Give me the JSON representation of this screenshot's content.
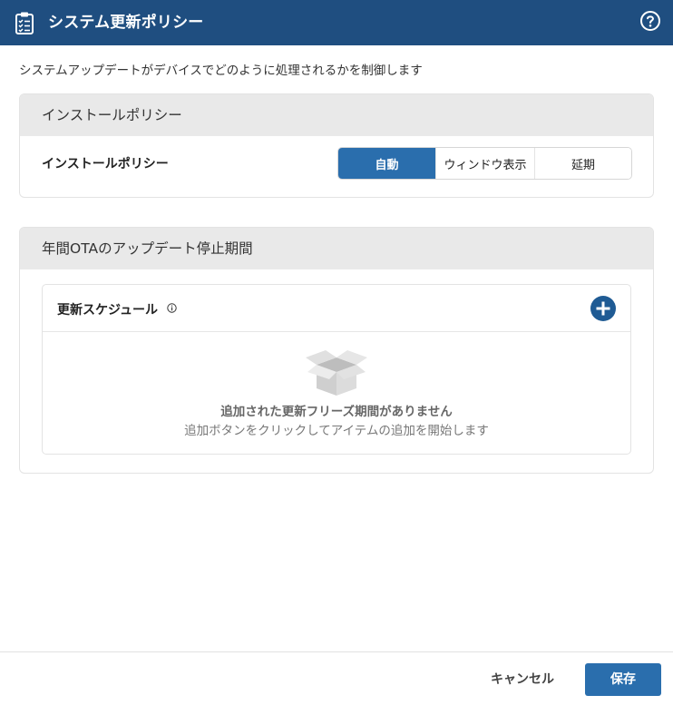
{
  "window": {
    "title": "システム更新ポリシー",
    "icons": {
      "app": "clipboard-checklist-icon",
      "help": "help-circle-icon"
    }
  },
  "description": "システムアップデートがデバイスでどのように処理されるかを制御します",
  "install_policy": {
    "section_title": "インストールポリシー",
    "label": "インストールポリシー",
    "options": [
      "自動",
      "ウィンドウ表示",
      "延期"
    ],
    "selected": "自動"
  },
  "freeze_period": {
    "section_title": "年間OTAのアップデート停止期間",
    "schedule_title": "更新スケジュール",
    "empty_title": "追加された更新フリーズ期間がありません",
    "empty_subtitle": "追加ボタンをクリックしてアイテムの追加を開始します",
    "icons": {
      "info": "info-icon",
      "add": "plus-circle-icon",
      "empty": "open-box-icon"
    }
  },
  "footer": {
    "cancel_label": "キャンセル",
    "save_label": "保存"
  },
  "colors": {
    "titlebar": "#1f4e80",
    "accent": "#2a6ead",
    "section_header_bg": "#e9e9e9"
  }
}
